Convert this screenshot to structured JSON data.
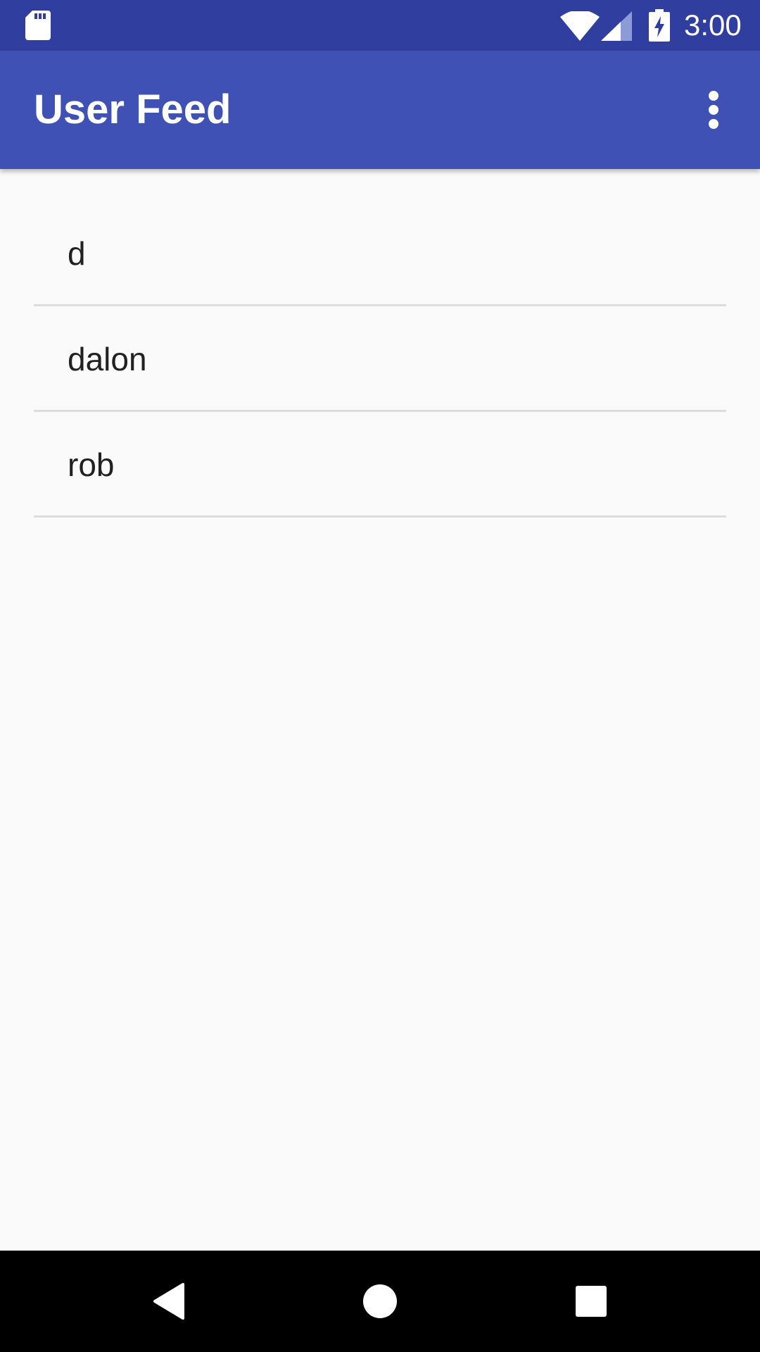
{
  "status_bar": {
    "time": "3:00",
    "icons": [
      "sd-card-icon",
      "wifi-icon",
      "cell-signal-icon",
      "battery-charging-icon"
    ],
    "background": "#303f9f"
  },
  "app_bar": {
    "title": "User Feed",
    "background": "#3f51b5",
    "overflow_icon": "more-vert-icon"
  },
  "users": [
    {
      "name": "d"
    },
    {
      "name": "dalon"
    },
    {
      "name": "rob"
    }
  ],
  "nav_bar": {
    "buttons": [
      "back-icon",
      "home-icon",
      "recents-icon"
    ],
    "background": "#000000"
  },
  "colors": {
    "page_background": "#fafafa",
    "divider": "#dcdcdc",
    "text_primary": "#212121"
  }
}
